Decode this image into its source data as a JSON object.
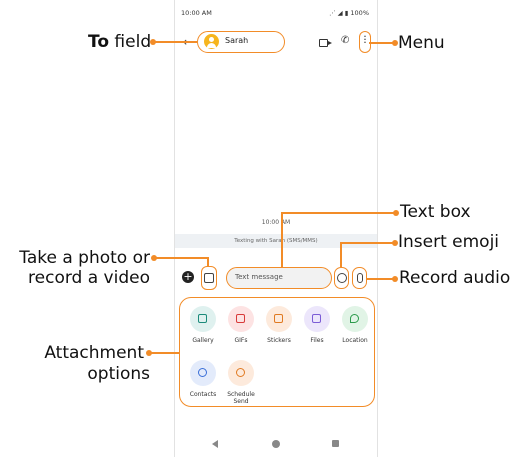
{
  "status_bar": {
    "time": "10:00 AM",
    "battery": "100%"
  },
  "header": {
    "contact_name": "Sarah"
  },
  "conversation": {
    "timestamp": "10:00 AM",
    "banner": "Texting with Sarah (SMS/MMS)"
  },
  "compose": {
    "placeholder": "Text message"
  },
  "attachments": [
    {
      "label": "Gallery",
      "icon": "gallery-icon",
      "bg": "#dff1ef",
      "fg": "#1a8a7a"
    },
    {
      "label": "GIFs",
      "icon": "gif-icon",
      "bg": "#fde3e3",
      "fg": "#d83a3a"
    },
    {
      "label": "Stickers",
      "icon": "sticker-icon",
      "bg": "#fdeadc",
      "fg": "#e07a22"
    },
    {
      "label": "Files",
      "icon": "file-icon",
      "bg": "#ece6fb",
      "fg": "#7b5cd6"
    },
    {
      "label": "Location",
      "icon": "location-icon",
      "bg": "#e1f4e6",
      "fg": "#2a9a4a"
    },
    {
      "label": "Contacts",
      "icon": "contacts-icon",
      "bg": "#e3ebfb",
      "fg": "#3a6fd8"
    },
    {
      "label": "Schedule Send",
      "icon": "clock-icon",
      "bg": "#fdeadc",
      "fg": "#e07a22"
    }
  ],
  "callouts": {
    "to_field_bold": "To",
    "to_field_rest": " field",
    "menu": "Menu",
    "text_box": "Text box",
    "insert_emoji": "Insert emoji",
    "record_audio": "Record audio",
    "take_photo_line1": "Take a photo or",
    "take_photo_line2": "record a video",
    "attachment_line1": "Attachment",
    "attachment_line2": "options"
  },
  "accent_color": "#f28c28"
}
